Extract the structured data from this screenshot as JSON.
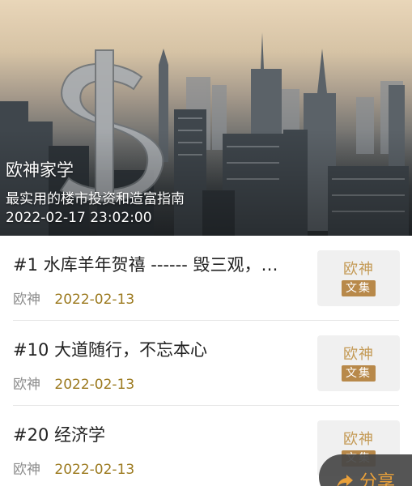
{
  "hero": {
    "title": "欧神家学",
    "subtitle": "最实用的楼市投资和造富指南",
    "date": "2022-02-17 23:02:00"
  },
  "articles": [
    {
      "title": "#1 水库羊年贺禧 ------ 毁三观，…",
      "author": "欧神",
      "date": "2022-02-13",
      "thumb_top": "欧神",
      "thumb_bottom": "文集"
    },
    {
      "title": "#10 大道随行，不忘本心",
      "author": "欧神",
      "date": "2022-02-13",
      "thumb_top": "欧神",
      "thumb_bottom": "文集"
    },
    {
      "title": "#20 经济学",
      "author": "欧神",
      "date": "2022-02-13",
      "thumb_top": "欧神",
      "thumb_bottom": "文集"
    }
  ],
  "share": {
    "label": "分享",
    "icon": "share-arrow-icon"
  },
  "colors": {
    "date_accent": "#9c7a1f",
    "share_accent": "#e9a03a",
    "thumb_gold": "#b8894a"
  }
}
